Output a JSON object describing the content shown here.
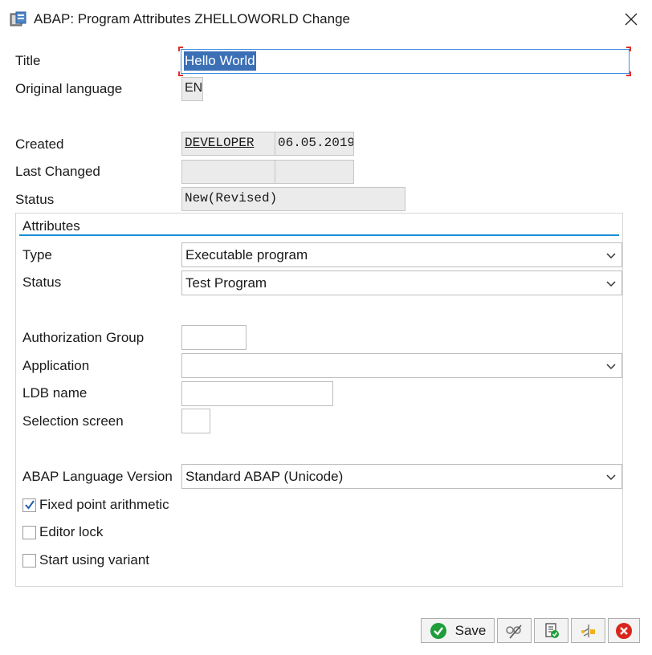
{
  "window": {
    "title": "ABAP: Program Attributes ZHELLOWORLD Change"
  },
  "fields": {
    "title_label": "Title",
    "title_value": "Hello World",
    "original_language_label": "Original language",
    "original_language_value": "EN",
    "created_label": "Created",
    "created_by": "DEVELOPER",
    "created_date": "06.05.2019",
    "last_changed_label": "Last Changed",
    "last_changed_by": "",
    "last_changed_date": "",
    "status_label": "Status",
    "status_value": "New(Revised)"
  },
  "attributes": {
    "group_title": "Attributes",
    "type_label": "Type",
    "type_value": "Executable program",
    "status_label": "Status",
    "status_value": "Test Program",
    "auth_group_label": "Authorization Group",
    "auth_group_value": "",
    "application_label": "Application",
    "application_value": "",
    "ldb_label": "LDB name",
    "ldb_value": "",
    "selection_screen_label": "Selection screen",
    "selection_screen_value": "",
    "abap_version_label": "ABAP Language Version",
    "abap_version_value": "Standard ABAP (Unicode)",
    "checkboxes": [
      {
        "label": "Fixed point arithmetic",
        "checked": true
      },
      {
        "label": "Editor lock",
        "checked": false
      },
      {
        "label": "Start using variant",
        "checked": false
      }
    ]
  },
  "buttons": {
    "save_label": "Save"
  },
  "colors": {
    "accent": "#1a8fd6",
    "selection": "#3b6fb6",
    "save_icon": "#1e9e3a",
    "cancel_icon": "#d9261c"
  }
}
